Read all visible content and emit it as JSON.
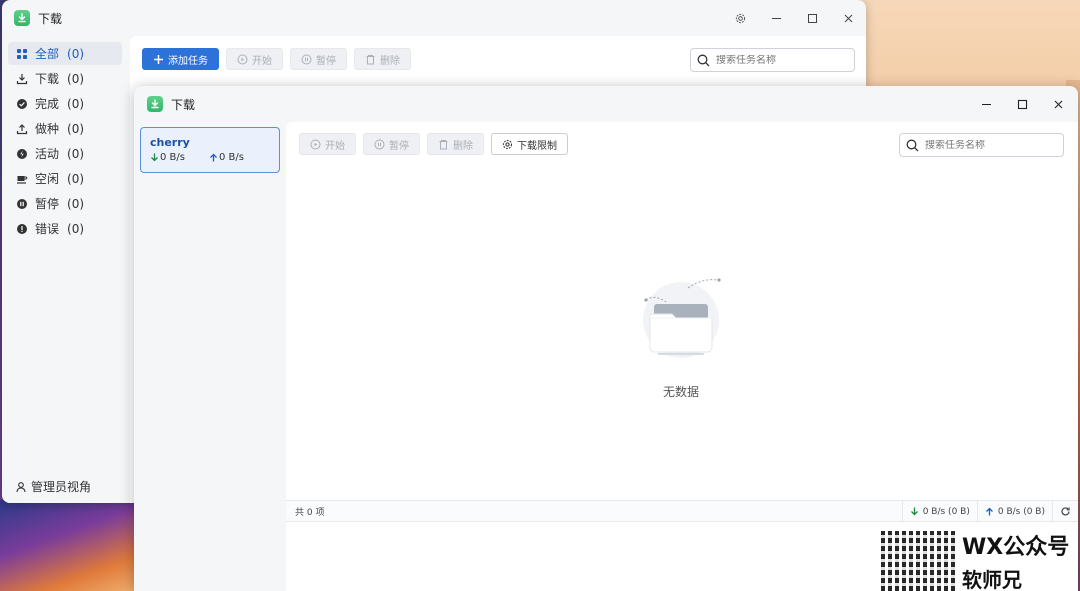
{
  "back_window": {
    "title": "下载",
    "sidebar": [
      {
        "label": "全部",
        "count": "(0)",
        "icon": "grid-icon"
      },
      {
        "label": "下载",
        "count": "(0)",
        "icon": "download-icon"
      },
      {
        "label": "完成",
        "count": "(0)",
        "icon": "check-circle-icon"
      },
      {
        "label": "做种",
        "count": "(0)",
        "icon": "upload-icon"
      },
      {
        "label": "活动",
        "count": "(0)",
        "icon": "activity-icon"
      },
      {
        "label": "空闲",
        "count": "(0)",
        "icon": "coffee-icon"
      },
      {
        "label": "暂停",
        "count": "(0)",
        "icon": "pause-circle-icon"
      },
      {
        "label": "错误",
        "count": "(0)",
        "icon": "error-circle-icon"
      }
    ],
    "admin_view": "管理员视角",
    "toolbar": {
      "add_task": "添加任务",
      "start": "开始",
      "pause": "暂停",
      "delete": "删除"
    },
    "search_placeholder": "搜索任务名称"
  },
  "front_window": {
    "title": "下载",
    "device": {
      "name": "cherry",
      "down_speed": "0 B/s",
      "up_speed": "0 B/s"
    },
    "toolbar": {
      "start": "开始",
      "pause": "暂停",
      "delete": "删除",
      "speed_limit": "下载限制"
    },
    "search_placeholder": "搜索任务名称",
    "empty_text": "无数据",
    "status": {
      "total": "共 0 项",
      "down": "0 B/s (0 B)",
      "up": "0 B/s (0 B)"
    }
  },
  "watermark": {
    "line1": "WX公众号",
    "line2": "软师兄"
  },
  "colors": {
    "primary": "#2d72d9",
    "app_green": "#2fb86a",
    "down_arrow": "#1f8a3b",
    "up_arrow": "#1d5fc4"
  }
}
